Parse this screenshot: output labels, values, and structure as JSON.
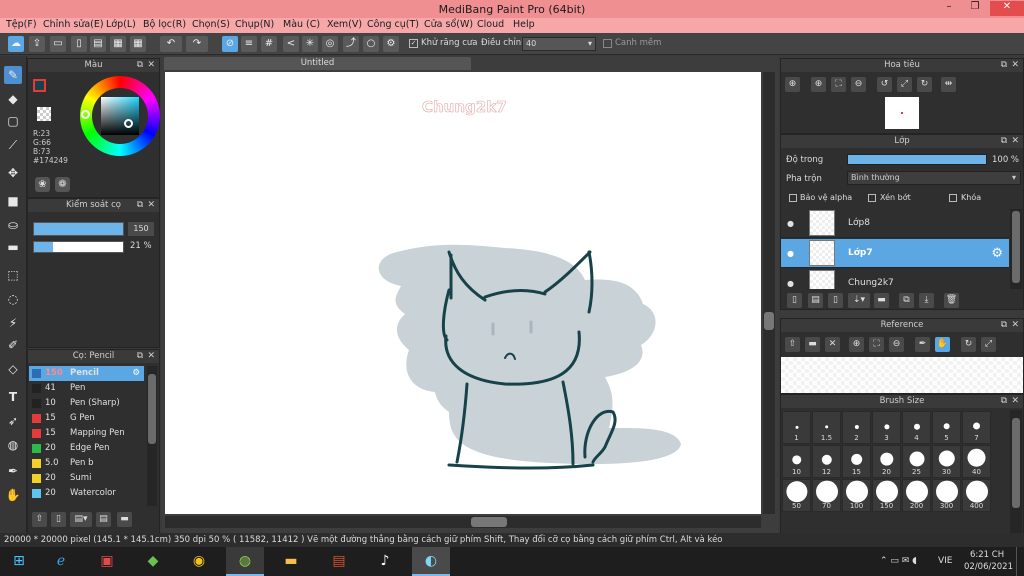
{
  "window": {
    "title": "MediBang Paint Pro (64bit)",
    "min": "–",
    "max": "❐",
    "close": "✕"
  },
  "menu": [
    "Tệp(F)",
    "Chỉnh sửa(E)",
    "Lớp(L)",
    "Bộ lọc(R)",
    "Chọn(S)",
    "Chụp(N)",
    "Màu (C)",
    "Xem(V)",
    "Công cụ(T)",
    "Cửa sổ(W)",
    "Cloud",
    "Help"
  ],
  "toolbar": {
    "antialias_label": "Khử răng cưa",
    "adjust_label": "Điều chỉnh",
    "adjust_value": "40",
    "snap_label": "Canh mềm"
  },
  "color_panel": {
    "title": "Màu",
    "r": "R:23",
    "g": "G:66",
    "b": "B:73",
    "hex": "#174249",
    "fg": "#174249"
  },
  "brush_control": {
    "title": "Kiểm soát cọ",
    "size_value": "150",
    "opacity_value": "21 %",
    "size_fraction": 0.999,
    "opacity_fraction": 0.21
  },
  "brush_panel": {
    "title": "Cọ: Pencil",
    "brushes": [
      {
        "size": "150",
        "name": "Pencil",
        "color": "#2a6fb5",
        "selected": true
      },
      {
        "size": "41",
        "name": "Pen",
        "color": "#222222"
      },
      {
        "size": "10",
        "name": "Pen (Sharp)",
        "color": "#222222"
      },
      {
        "size": "15",
        "name": "G Pen",
        "color": "#e53b3b"
      },
      {
        "size": "15",
        "name": "Mapping Pen",
        "color": "#e53b3b"
      },
      {
        "size": "20",
        "name": "Edge Pen",
        "color": "#2fb84a"
      },
      {
        "size": "5.0",
        "name": "Pen b",
        "color": "#f2d027"
      },
      {
        "size": "20",
        "name": "Sumi",
        "color": "#f2d027"
      },
      {
        "size": "20",
        "name": "Watercolor",
        "color": "#5ec4f0"
      }
    ]
  },
  "canvas": {
    "tab": "Untitled",
    "watermark": "Chung2k7",
    "bg": "#c9d2d7",
    "ink": "#174249"
  },
  "navigator": {
    "title": "Hoa tiêu"
  },
  "layers": {
    "title": "Lớp",
    "opacity_label": "Độ trong",
    "opacity_value": "100 %",
    "opacity_fraction": 1.0,
    "blend_label": "Pha trộn",
    "blend_value": "Bình thường",
    "protect_alpha": "Bảo vệ alpha",
    "clipping": "Xén bớt",
    "lock": "Khóa",
    "items": [
      {
        "name": "Lớp8",
        "selected": false
      },
      {
        "name": "Lớp7",
        "selected": true
      },
      {
        "name": "Chung2k7",
        "selected": false
      }
    ]
  },
  "reference": {
    "title": "Reference"
  },
  "brush_size": {
    "title": "Brush Size",
    "sizes": [
      "1",
      "1.5",
      "2",
      "3",
      "4",
      "5",
      "7",
      "10",
      "12",
      "15",
      "20",
      "25",
      "30",
      "40",
      "50",
      "70",
      "100",
      "150",
      "200",
      "300",
      "400"
    ]
  },
  "status": {
    "text": "20000 * 20000 pixel   (145.1 * 145.1cm)   350 dpi   50 %   ( 11582, 11412 )   Vẽ một đường thẳng bằng cách giữ phím Shift, Thay đổi cỡ cọ bằng cách giữ phím Ctrl, Alt và kéo"
  },
  "taskbar": {
    "lang": "VIE",
    "time": "6:21 CH",
    "date": "02/06/2021"
  }
}
